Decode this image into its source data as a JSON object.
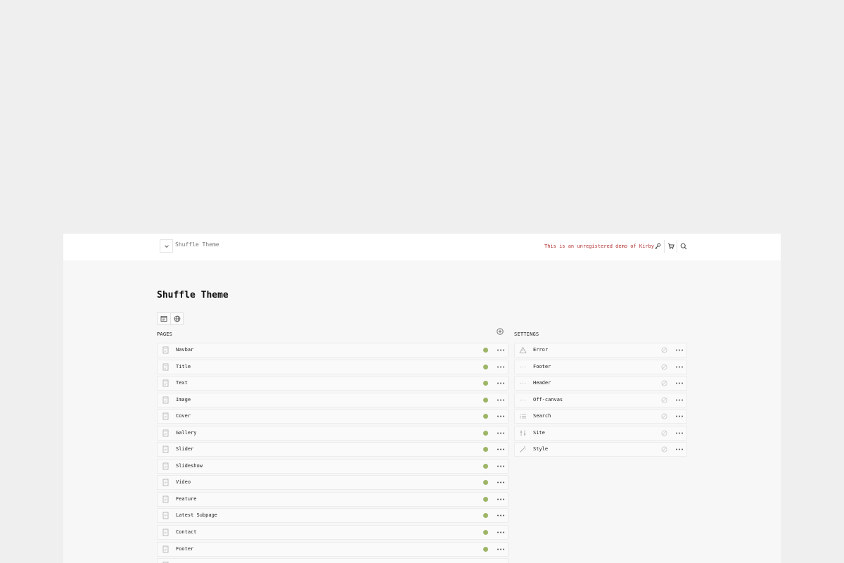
{
  "header": {
    "site_title": "Shuffle Theme",
    "notice": "This is an unregistered demo of Kirby",
    "menu_icon": "chevron-down-icon",
    "tools": [
      "key-icon",
      "cart-icon",
      "search-icon"
    ]
  },
  "page": {
    "title": "Shuffle Theme",
    "view_buttons": [
      "preview-icon",
      "globe-icon"
    ]
  },
  "pages": {
    "heading": "PAGES",
    "status_color": "#9db566",
    "items": [
      {
        "label": "Navbar"
      },
      {
        "label": "Title"
      },
      {
        "label": "Text"
      },
      {
        "label": "Image"
      },
      {
        "label": "Cover"
      },
      {
        "label": "Gallery"
      },
      {
        "label": "Slider"
      },
      {
        "label": "Slideshow"
      },
      {
        "label": "Video"
      },
      {
        "label": "Feature"
      },
      {
        "label": "Latest Subpage"
      },
      {
        "label": "Contact"
      },
      {
        "label": "Footer"
      },
      {
        "label": ""
      }
    ]
  },
  "settings": {
    "heading": "SETTINGS",
    "items": [
      {
        "label": "Error",
        "icon": "alert-icon"
      },
      {
        "label": "Footer",
        "icon": "dots-icon"
      },
      {
        "label": "Header",
        "icon": "dots-icon"
      },
      {
        "label": "Off-canvas",
        "icon": "dots-icon"
      },
      {
        "label": "Search",
        "icon": "list-icon"
      },
      {
        "label": "Site",
        "icon": "sliders-icon"
      },
      {
        "label": "Style",
        "icon": "wand-icon"
      }
    ]
  }
}
